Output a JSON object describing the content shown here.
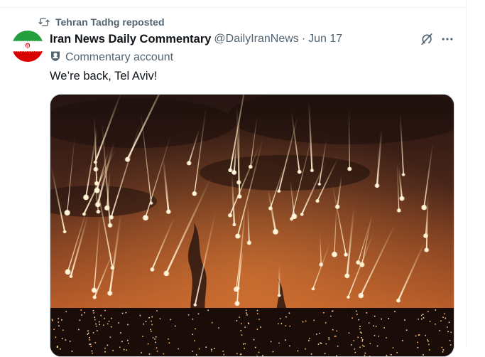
{
  "repost": {
    "text": "Tehran Tadhg reposted",
    "icon": "repost-icon"
  },
  "tweet": {
    "display_name": "Iran News Daily Commentary",
    "handle": "@DailyIranNews",
    "separator": "·",
    "date": "Jun 17",
    "account_label": "Commentary account",
    "account_label_icon": "bust-icon",
    "text": "We’re back, Tel Aviv!",
    "avatar_icon": "iran-flag-icon",
    "media_icon": "missile-night-sky-photo"
  },
  "actions": {
    "grok_icon": "grok-icon",
    "more_icon": "more-icon"
  },
  "colors": {
    "primary_text": "#0f1419",
    "secondary_text": "#536471",
    "border": "#eff3f4",
    "flag_green": "#239f40",
    "flag_red": "#da0000"
  }
}
